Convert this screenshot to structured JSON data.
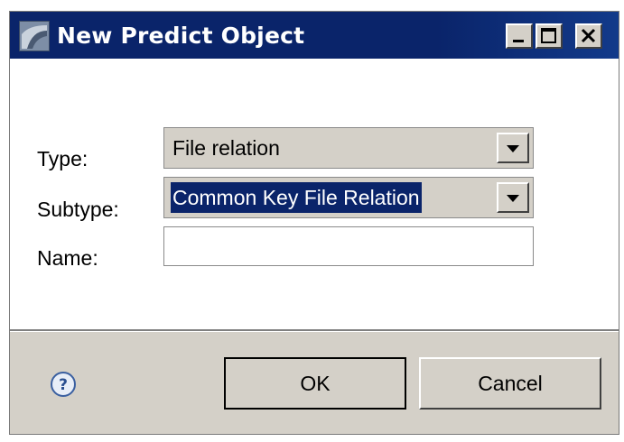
{
  "window": {
    "title": "New Predict Object",
    "app_icon": "predict-app-icon",
    "controls": [
      "minimize-icon",
      "maximize-icon",
      "close-icon"
    ]
  },
  "form": {
    "type_label": "Type:",
    "type_value": "File relation",
    "subtype_label": "Subtype:",
    "subtype_value": "Common Key File Relation",
    "name_label": "Name:",
    "name_value": ""
  },
  "footer": {
    "help_icon": "help-icon",
    "ok_label": "OK",
    "cancel_label": "Cancel"
  },
  "colors": {
    "titlebar": "#0a246a",
    "selection": "#0a246a",
    "dialog_bg": "#d4d0c8"
  }
}
